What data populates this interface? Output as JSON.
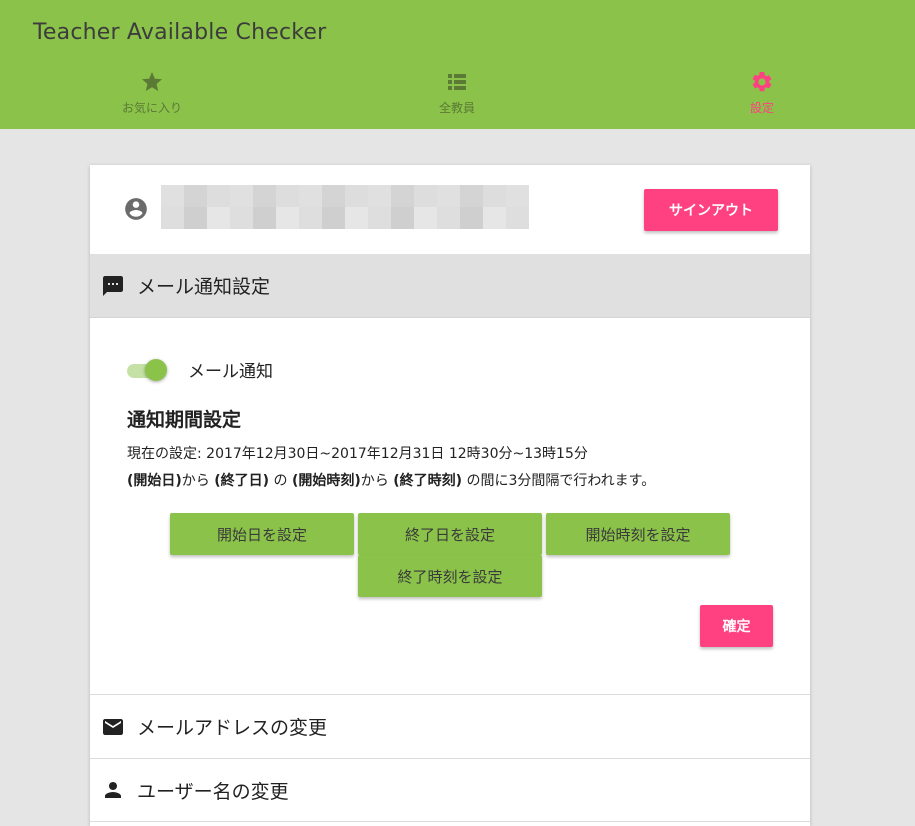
{
  "app": {
    "title": "Teacher Available Checker"
  },
  "nav": {
    "items": [
      {
        "label": "お気に入り",
        "icon": "star-icon"
      },
      {
        "label": "全教員",
        "icon": "list-icon"
      },
      {
        "label": "設定",
        "icon": "gear-icon",
        "active": true
      }
    ]
  },
  "colors": {
    "primary": "#8bc34a",
    "accent": "#ff4081",
    "background": "#e5e5e5"
  },
  "account": {
    "icon": "account-circle-icon",
    "signout_label": "サインアウト"
  },
  "mail_settings": {
    "header": "メール通知設定",
    "icon": "chat-icon",
    "toggle_label": "メール通知",
    "toggle_on": true,
    "period_title": "通知期間設定",
    "current_setting": "現在の設定: 2017年12月30日~2017年12月31日 12時30分~13時15分",
    "desc": {
      "start_date": "(開始日)",
      "from1": "から ",
      "end_date": "(終了日)",
      "no": " の ",
      "start_time": "(開始時刻)",
      "from2": "から ",
      "end_time": "(終了時刻)",
      "tail": " の間に3分間隔で行われます。"
    },
    "buttons": {
      "start_date": "開始日を設定",
      "end_date": "終了日を設定",
      "start_time": "開始時刻を設定",
      "end_time": "終了時刻を設定",
      "confirm": "確定"
    }
  },
  "sections": {
    "email_change": {
      "label": "メールアドレスの変更",
      "icon": "mail-icon"
    },
    "username_change": {
      "label": "ユーザー名の変更",
      "icon": "person-icon"
    }
  }
}
